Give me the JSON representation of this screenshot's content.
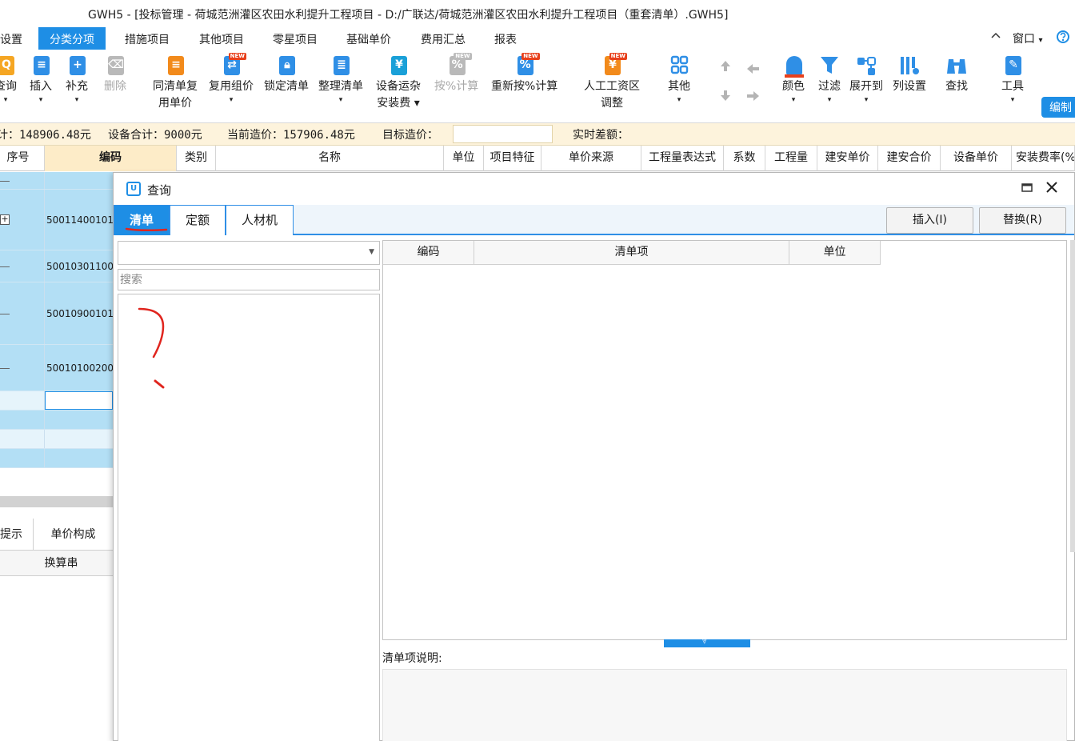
{
  "window": {
    "title": "GWH5 - [投标管理 - 荷城范洲灌区农田水利提升工程项目 - D:/广联达/荷城范洲灌区农田水利提升工程项目（重套清单）.GWH5]",
    "window_menu": "窗口",
    "window_menu_arrow": "▾",
    "collapse_icon": "chevron-up-icon"
  },
  "menu": {
    "items": [
      "设置",
      "分类分项",
      "措施项目",
      "其他项目",
      "零星项目",
      "基础单价",
      "费用汇总",
      "报表"
    ],
    "active": "分类分项"
  },
  "toolbar": {
    "buttons": [
      {
        "label": "查询",
        "arrow": "▾"
      },
      {
        "label": "插入",
        "arrow": "▾"
      },
      {
        "label": "补充",
        "arrow": "▾"
      },
      {
        "label": "删除",
        "arrow": ""
      },
      {
        "label": "同清单复\n用单价",
        "arrow": ""
      },
      {
        "label": "复用组价",
        "arrow": "▾",
        "new": "NEW"
      },
      {
        "label": "锁定清单",
        "arrow": ""
      },
      {
        "label": "整理清单",
        "arrow": "▾"
      },
      {
        "label": "设备运杂\n安装费 ▾",
        "arrow": ""
      },
      {
        "label": "按%计算",
        "arrow": "",
        "new": "NEW"
      },
      {
        "label": "重新按%计算",
        "arrow": "",
        "new": "NEW"
      },
      {
        "label": "人工工资区\n调整",
        "arrow": "",
        "new": "NEW"
      },
      {
        "label": "其他",
        "arrow": "▾"
      },
      {
        "label": "颜色",
        "arrow": "▾"
      },
      {
        "label": "过滤",
        "arrow": "▾"
      },
      {
        "label": "展开到",
        "arrow": "▾"
      },
      {
        "label": "列设置",
        "arrow": ""
      },
      {
        "label": "查找",
        "arrow": ""
      },
      {
        "label": "工具",
        "arrow": "▾"
      }
    ],
    "edit_button": "编制"
  },
  "summary": {
    "subtotal": "计：148906.48元",
    "equipment_total": "设备合计：9000元",
    "current_cost": "当前造价：157906.48元",
    "target_label": "目标造价：",
    "target_value": "",
    "diff_label": "实时差额："
  },
  "table": {
    "headers": [
      "序号",
      "编码",
      "类别",
      "名称",
      "单位",
      "项目特征",
      "单价来源",
      "工程量表达式",
      "系数",
      "工程量",
      "建安单价",
      "建安合价",
      "设备单价",
      "安装费率(%"
    ],
    "rows": [
      {
        "code": ""
      },
      {
        "code": "50011400101",
        "expand": "+"
      },
      {
        "code": "50010301100"
      },
      {
        "code": "50010900101"
      },
      {
        "code": "50010100200"
      },
      {
        "code": ""
      },
      {
        "code": ""
      },
      {
        "code": ""
      },
      {
        "code": ""
      }
    ]
  },
  "lower_panel": {
    "tab_hint": "提示",
    "tab_price": "单价构成",
    "conversion": "换算串"
  },
  "dialog": {
    "title": "查询",
    "tabs": [
      "清单",
      "定额",
      "人材机"
    ],
    "active_tab": "清单",
    "insert_button": "插入(I)",
    "replace_button": "替换(R)",
    "library_select": "",
    "search_placeholder": "搜索",
    "grid_headers": [
      "编码",
      "清单项",
      "单位"
    ],
    "description_label": "清单项说明:"
  },
  "colors": {
    "accent": "#1e8ee5",
    "row_highlight": "#b3dff5",
    "summary_bg": "#fdf3dc",
    "annotation": "#e0251e"
  }
}
